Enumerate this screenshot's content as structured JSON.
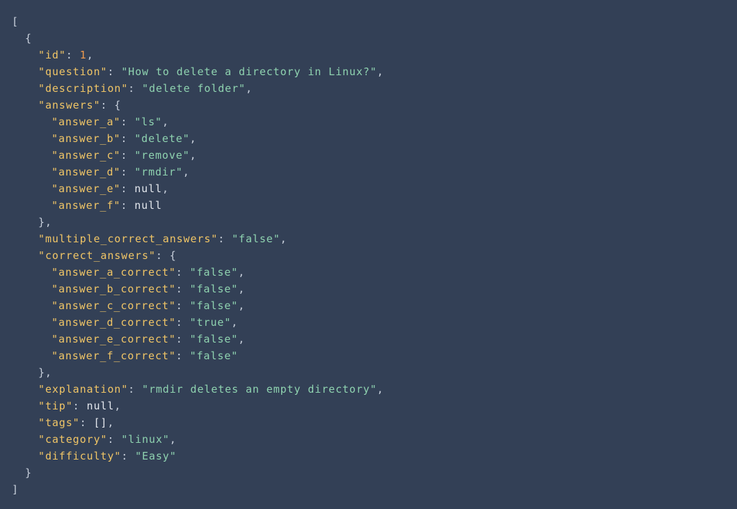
{
  "colors": {
    "background": "#334056",
    "punctuation": "#c8d0dc",
    "key": "#f0c566",
    "string": "#8fd3b0",
    "number": "#f09a4e",
    "literal": "#e4e8ee"
  },
  "json": {
    "id_key": "id",
    "id_value": "1",
    "question_key": "question",
    "question_value": "How to delete a directory in Linux?",
    "description_key": "description",
    "description_value": "delete folder",
    "answers_key": "answers",
    "answers": [
      {
        "key": "answer_a",
        "value": "ls",
        "type": "string"
      },
      {
        "key": "answer_b",
        "value": "delete",
        "type": "string"
      },
      {
        "key": "answer_c",
        "value": "remove",
        "type": "string"
      },
      {
        "key": "answer_d",
        "value": "rmdir",
        "type": "string"
      },
      {
        "key": "answer_e",
        "value": "null",
        "type": "literal"
      },
      {
        "key": "answer_f",
        "value": "null",
        "type": "literal"
      }
    ],
    "multiple_key": "multiple_correct_answers",
    "multiple_value": "false",
    "correct_key": "correct_answers",
    "correct_answers": [
      {
        "key": "answer_a_correct",
        "value": "false"
      },
      {
        "key": "answer_b_correct",
        "value": "false"
      },
      {
        "key": "answer_c_correct",
        "value": "false"
      },
      {
        "key": "answer_d_correct",
        "value": "true"
      },
      {
        "key": "answer_e_correct",
        "value": "false"
      },
      {
        "key": "answer_f_correct",
        "value": "false"
      }
    ],
    "explanation_key": "explanation",
    "explanation_value": "rmdir deletes an empty directory",
    "tip_key": "tip",
    "tip_value": "null",
    "tags_key": "tags",
    "tags_value": "[]",
    "category_key": "category",
    "category_value": "linux",
    "difficulty_key": "difficulty",
    "difficulty_value": "Easy"
  }
}
